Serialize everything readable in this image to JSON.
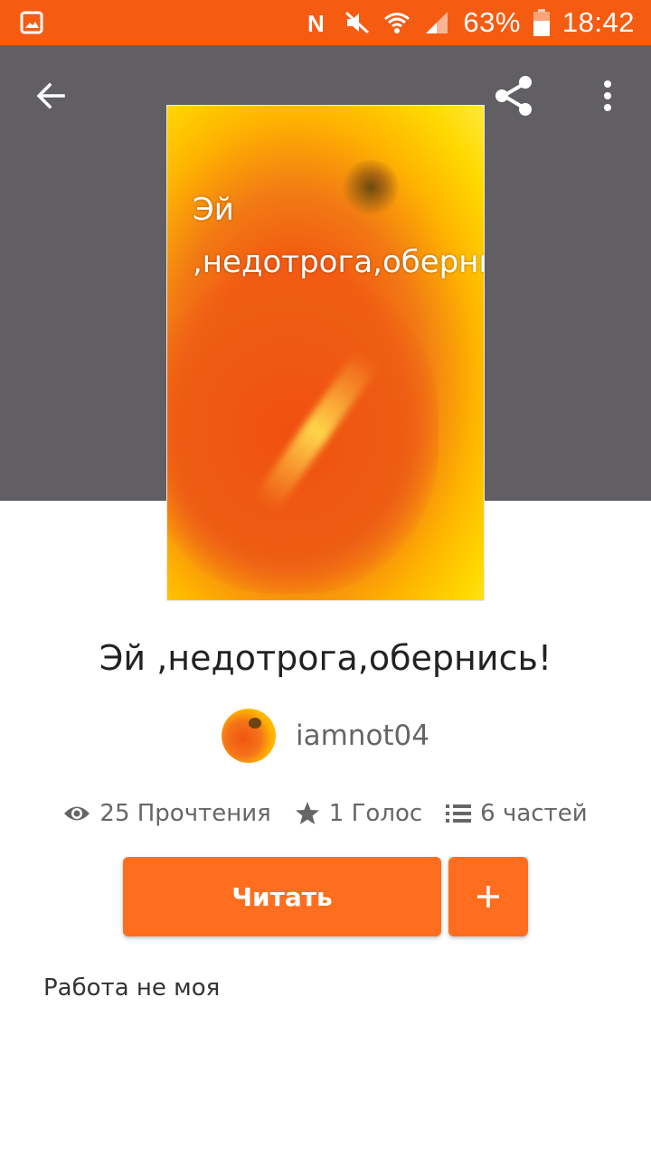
{
  "status_bar": {
    "battery": "63%",
    "time": "18:42",
    "icons": [
      "gallery-icon",
      "nfc-icon",
      "mute-icon",
      "wifi-icon",
      "signal-icon",
      "battery-icon"
    ]
  },
  "toolbar": {
    "icons": [
      "back-arrow-icon",
      "share-icon",
      "more-vertical-icon"
    ]
  },
  "cover": {
    "title_line1": "Эй",
    "title_line2": ",недотрога,оберни"
  },
  "story": {
    "title": "Эй ,недотрога,обернись!",
    "author": "iamnot04",
    "stats": {
      "reads": "25 Прочтения",
      "votes": "1 Голос",
      "parts": "6 частей"
    },
    "read_button_label": "Читать",
    "add_button_icon": "plus-icon",
    "description": "Работа не моя"
  },
  "colors": {
    "accent": "#ff6e1e",
    "status_bar": "#f55c12",
    "header": "#615f64"
  }
}
